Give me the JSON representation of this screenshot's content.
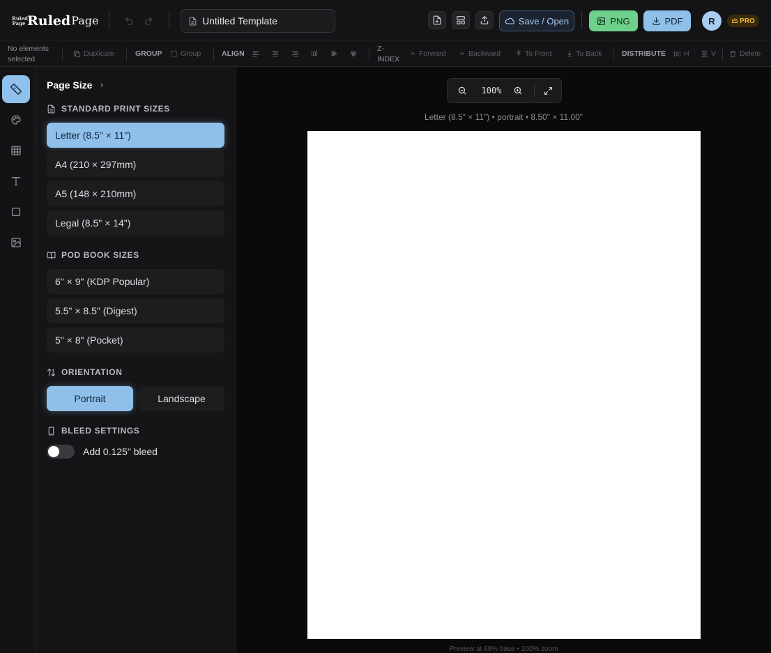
{
  "app": {
    "logo_mini": "Ruled Page",
    "logo_main": "Ruled",
    "logo_sub": "Page"
  },
  "header": {
    "doc_title": "Untitled Template",
    "save_label": "Save / Open",
    "png_label": "PNG",
    "pdf_label": "PDF",
    "avatar_initial": "R",
    "pro_label": "PRO"
  },
  "toolbar": {
    "selection_line1": "No elements",
    "selection_line2": "selected",
    "duplicate": "Duplicate",
    "group_label": "GROUP",
    "group_btn": "Group",
    "align_label": "ALIGN",
    "zindex_line1": "Z-",
    "zindex_line2": "INDEX",
    "forward": "Forward",
    "backward": "Backward",
    "to_front": "To Front",
    "to_back": "To Back",
    "distribute_label": "DISTRIBUTE",
    "dist_h": "H",
    "dist_v": "V",
    "delete": "Delete"
  },
  "panel": {
    "title": "Page Size",
    "standard_heading": "STANDARD PRINT SIZES",
    "standard_sizes": [
      {
        "label": "Letter (8.5\" × 11\")",
        "selected": true
      },
      {
        "label": "A4 (210 × 297mm)",
        "selected": false
      },
      {
        "label": "A5 (148 × 210mm)",
        "selected": false
      },
      {
        "label": "Legal (8.5\" × 14\")",
        "selected": false
      }
    ],
    "pod_heading": "POD BOOK SIZES",
    "pod_sizes": [
      {
        "label": "6\" × 9\" (KDP Popular)"
      },
      {
        "label": "5.5\" × 8.5\" (Digest)"
      },
      {
        "label": "5\" × 8\" (Pocket)"
      }
    ],
    "orientation_heading": "ORIENTATION",
    "portrait": "Portrait",
    "landscape": "Landscape",
    "orientation_selected": "Portrait",
    "bleed_heading": "BLEED SETTINGS",
    "bleed_label": "Add 0.125\" bleed",
    "bleed_on": false
  },
  "canvas": {
    "zoom": "100%",
    "page_info": "Letter (8.5\" × 11\") • portrait • 8.50\" × 11.00\"",
    "preview_note": "Preview at 69% base • 100% zoom"
  },
  "colors": {
    "accent": "#8ec0ea",
    "png_green": "#6fd08c",
    "pro_gold": "#e9b43a"
  }
}
